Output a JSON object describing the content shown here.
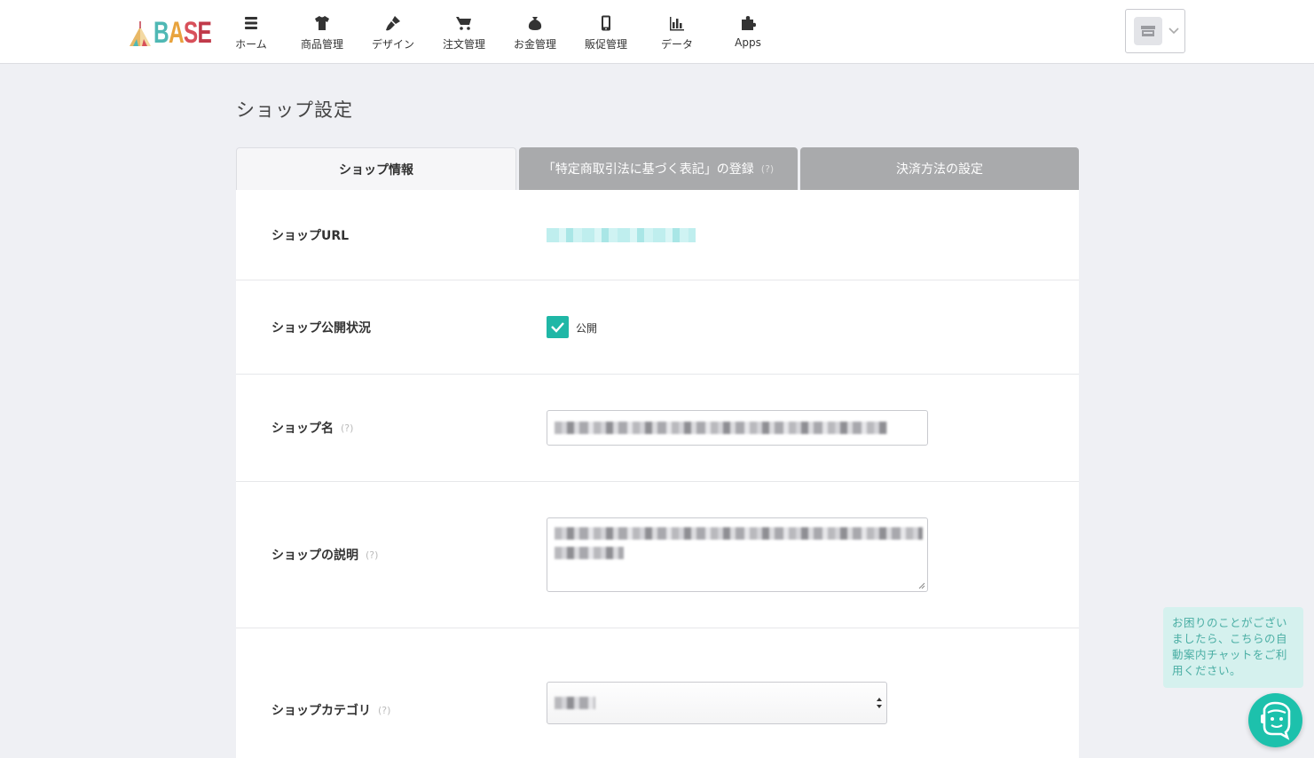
{
  "brand": {
    "logo_text": [
      "B",
      "A",
      "S",
      "E"
    ]
  },
  "nav": {
    "items": [
      {
        "label": "ホーム",
        "icon": "home-list-icon"
      },
      {
        "label": "商品管理",
        "icon": "tshirt-icon"
      },
      {
        "label": "デザイン",
        "icon": "paintbrush-icon"
      },
      {
        "label": "注文管理",
        "icon": "cart-icon"
      },
      {
        "label": "お金管理",
        "icon": "money-bag-icon"
      },
      {
        "label": "販促管理",
        "icon": "smartphone-icon"
      },
      {
        "label": "データ",
        "icon": "bar-chart-icon"
      },
      {
        "label": "Apps",
        "icon": "puzzle-icon"
      }
    ]
  },
  "account": {
    "icon": "shop-avatar-icon",
    "menu_icon": "chevron-down-icon"
  },
  "page": {
    "title": "ショップ設定",
    "tabs": [
      {
        "label": "ショップ情報",
        "active": true
      },
      {
        "label": "「特定商取引法に基づく表記」の登録",
        "help": "(?)"
      },
      {
        "label": "決済方法の設定"
      }
    ]
  },
  "form": {
    "url_label": "ショップURL",
    "status_label": "ショップ公開状況",
    "status_value": "公開",
    "status_checked": true,
    "name_label": "ショップ名",
    "name_help": "(?)",
    "desc_label": "ショップの説明",
    "desc_help": "(?)",
    "category_label": "ショップカテゴリ",
    "category_help": "(?)"
  },
  "chat": {
    "message": "お困りのことがございましたら、こちらの自動案内チャットをご利用ください。",
    "icon": "chat-bot-icon"
  },
  "colors": {
    "accent": "#1fb7a6",
    "tab_inactive": "#a9aaac",
    "background": "#eff0f4"
  }
}
